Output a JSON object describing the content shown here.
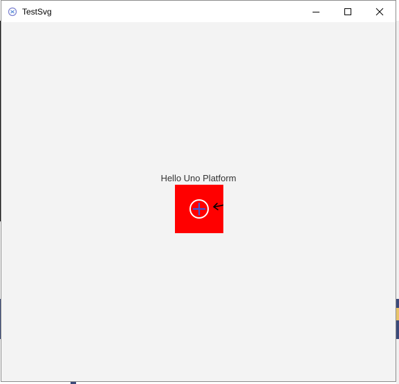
{
  "window": {
    "title": "TestSvg",
    "buttons": {
      "minimize": "minimize-icon",
      "maximize": "maximize-icon",
      "close": "close-icon"
    }
  },
  "content": {
    "greeting": "Hello Uno Platform",
    "svg_tile": {
      "background": "#ff0000",
      "icon": "add-circle-with-arrow-icon",
      "ring_color": "#ffffff",
      "plus_color": "#3a5bd9",
      "arrow_color": "#000000"
    }
  },
  "colors": {
    "window_bg": "#f3f3f3",
    "titlebar_bg": "#ffffff"
  }
}
